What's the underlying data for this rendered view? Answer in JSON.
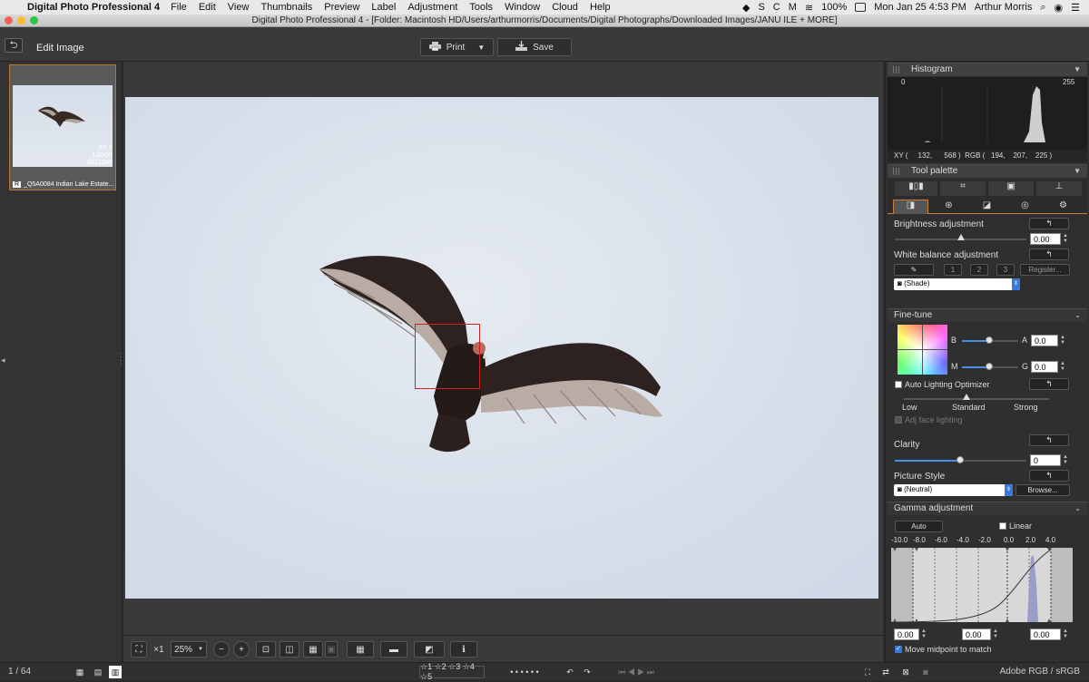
{
  "menubar": {
    "app_name": "Digital Photo Professional 4",
    "items": [
      "File",
      "Edit",
      "View",
      "Thumbnails",
      "Preview",
      "Label",
      "Adjustment",
      "Tools",
      "Window",
      "Cloud",
      "Help"
    ],
    "battery": "100%",
    "datetime": "Mon Jan 25  4:53 PM",
    "user": "Arthur Morris"
  },
  "window": {
    "title": "Digital Photo Professional 4 - [Folder: Macintosh HD/Users/arthurmorris/Documents/Digital Photographs/Downloaded Images/JANU ILE + MORE]"
  },
  "toolbar": {
    "mode_label": "Edit Image",
    "print_label": "Print",
    "save_label": "Save"
  },
  "thumbnail": {
    "aperture": "F7.1",
    "shutter": "1/2500",
    "iso": "ISO1250",
    "raw_tag": "R",
    "filename": "_Q5A0084  Indian Lake Estate..."
  },
  "viewer": {
    "zoom_value": "25%",
    "scale_label": "×1"
  },
  "status": {
    "page_count": "1 / 64",
    "color_space": "Adobe RGB / sRGB"
  },
  "histogram": {
    "title": "Histogram",
    "min_label": "0",
    "max_label": "255",
    "readout": "XY (     132,      568 )  RGB (   194,    207,    225 )"
  },
  "tool_palette": {
    "title": "Tool palette",
    "brightness": {
      "label": "Brightness adjustment",
      "value": "0.00",
      "level": 0.5
    },
    "white_balance": {
      "label": "White balance adjustment",
      "presets": [
        "1",
        "2",
        "3"
      ],
      "register_label": "Register...",
      "mode": "(Shade)"
    },
    "fine_tune": {
      "title": "Fine-tune",
      "b_label": "B",
      "a_label": "A",
      "a_value": "0.0",
      "m_label": "M",
      "g_label": "G",
      "g_value": "0.0"
    },
    "auto_lighting": {
      "label": "Auto Lighting Optimizer",
      "low": "Low",
      "standard": "Standard",
      "strong": "Strong",
      "face_label": "Adj face lighting"
    },
    "clarity": {
      "label": "Clarity",
      "value": "0"
    },
    "picture_style": {
      "label": "Picture Style",
      "value": "(Neutral)",
      "browse_label": "Browse..."
    },
    "gamma": {
      "title": "Gamma adjustment",
      "auto_label": "Auto",
      "linear_label": "Linear",
      "scale": [
        "-10.0",
        "-8.0",
        "-6.0",
        "-4.0",
        "-2.0",
        "0.0",
        "2.0",
        "4.0"
      ],
      "left_value": "0.00",
      "mid_value": "0.00",
      "right_value": "0.00",
      "midpoint_label": "Move midpoint to match"
    }
  },
  "colors": {
    "accent_blue": "#3b79d9",
    "focus_red": "#d02020",
    "selection_orange": "#b07a3a"
  }
}
